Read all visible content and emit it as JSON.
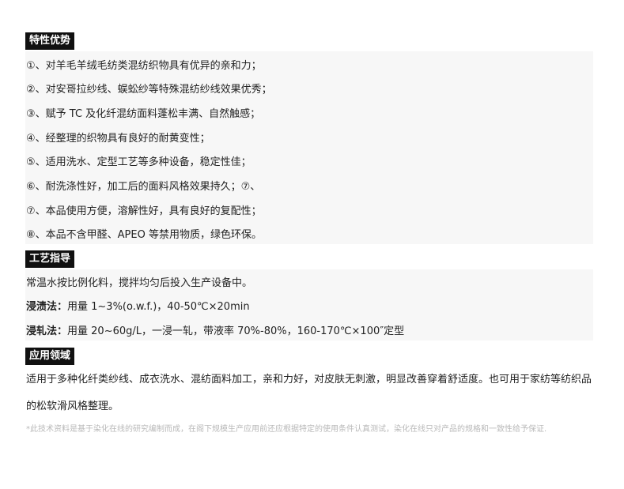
{
  "sections": {
    "features": {
      "title": "特性优势",
      "items": [
        "①、对羊毛羊绒毛纺类混纺织物具有优异的亲和力；",
        "②、对安哥拉纱线、蜈蚣纱等特殊混纺纱线效果优秀；",
        "③、赋予 TC 及化纤混纺面料蓬松丰满、自然触感；",
        "④、经整理的织物具有良好的耐黄变性；",
        "⑤、适用洗水、定型工艺等多种设备，稳定性佳；",
        "⑥、耐洗涤性好，加工后的面料风格效果持久；⑦、",
        "⑦、本品使用方便，溶解性好，具有良好的复配性；",
        "⑧、本品不含甲醛、APEO 等禁用物质，绿色环保。"
      ]
    },
    "process": {
      "title": "工艺指导",
      "intro": "常温水按比例化料，搅拌均匀后投入生产设备中。",
      "dip_label": "浸渍法：",
      "dip_value": "用量 1~3%(o.w.f.)，40-50℃×20min",
      "pad_label": "浸轧法：",
      "pad_value": "用量 20~60g/L，一浸一轧，带液率 70%-80%，160-170℃×100″定型"
    },
    "application": {
      "title": "应用领域",
      "text": "适用于多种化纤类纱线、成衣洗水、混纺面料加工，亲和力好，对皮肤无刺激，明显改善穿着舒适度。也可用于家纺等纺织品的松软滑风格整理。"
    }
  },
  "disclaimer": "*此技术资料是基于染化在线的研究编制而成，在阁下规模生产应用前还应根据特定的使用条件认真测试，染化在线只对产品的规格和一致性给予保证."
}
